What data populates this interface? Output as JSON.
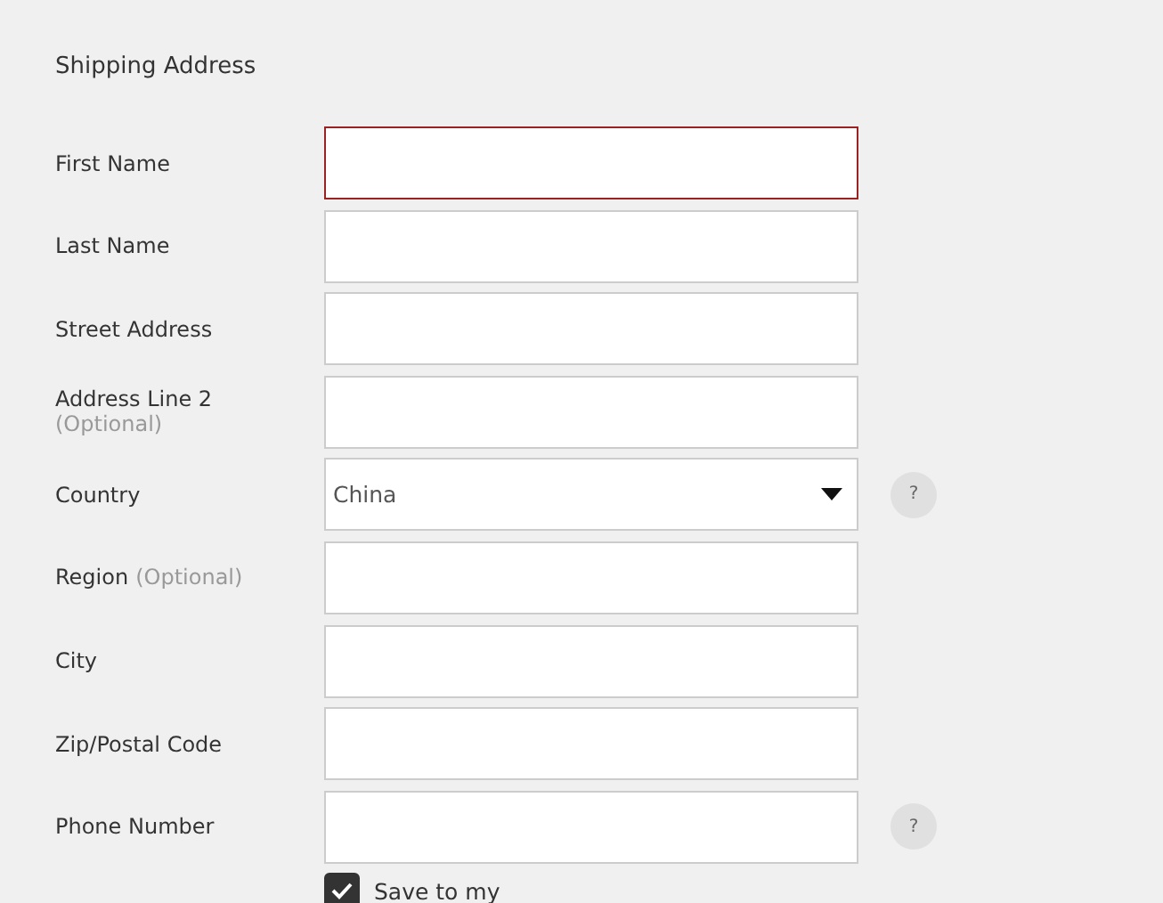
{
  "title": "Shipping Address",
  "fields": [
    {
      "label": "First Name",
      "kind": "text",
      "invalid": true,
      "help": false
    },
    {
      "label": "Last Name",
      "kind": "text",
      "invalid": false,
      "help": false
    },
    {
      "label": "Street Address",
      "kind": "text",
      "invalid": false,
      "help": false
    },
    {
      "label": "Address Line 2",
      "hint": "(Optional)",
      "kind": "text",
      "invalid": false,
      "help": false
    },
    {
      "label": "Country",
      "kind": "select",
      "value": "China",
      "invalid": false,
      "help": true,
      "help_text": "?"
    },
    {
      "label": "Region",
      "hint": "(Optional)",
      "kind": "text",
      "invalid": false,
      "help": false
    },
    {
      "label": "City",
      "kind": "text",
      "invalid": false,
      "help": false
    },
    {
      "label": "Zip/Postal Code",
      "kind": "text",
      "invalid": false,
      "help": false
    },
    {
      "label": "Phone Number",
      "kind": "text",
      "invalid": false,
      "help": true,
      "help_text": "?"
    }
  ],
  "save": {
    "label": "Save to my",
    "checked": true
  }
}
